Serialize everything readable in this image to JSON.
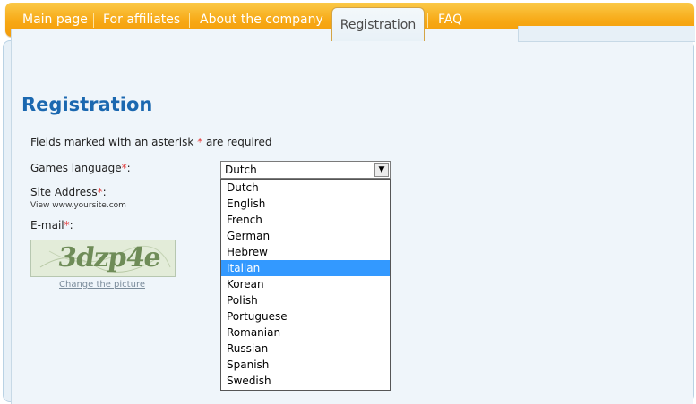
{
  "nav": {
    "items": [
      {
        "label": "Main page"
      },
      {
        "label": "For affiliates"
      },
      {
        "label": "About the company"
      },
      {
        "label": "Registration"
      },
      {
        "label": "FAQ"
      }
    ]
  },
  "page": {
    "title": "Registration",
    "required_note_prefix": "Fields marked with an asterisk",
    "required_note_asterisk": "*",
    "required_note_suffix": "are required"
  },
  "form": {
    "games_language_label": "Games language",
    "site_address_label": "Site Address",
    "site_address_hint": "View www.yoursite.com",
    "email_label": "E-mail",
    "asterisk": "*",
    "colon": ":",
    "captcha_text": "3dzp4e",
    "change_picture_label": "Change the picture"
  },
  "language_select": {
    "selected_value": "Dutch",
    "arrow_glyph": "▼",
    "highlighted": "Italian",
    "options": [
      "Dutch",
      "English",
      "French",
      "German",
      "Hebrew",
      "Italian",
      "Korean",
      "Polish",
      "Portuguese",
      "Romanian",
      "Russian",
      "Spanish",
      "Swedish"
    ]
  },
  "colors": {
    "nav_orange": "#f7a814",
    "title_blue": "#1b68b0",
    "required_red": "#e43b3b",
    "highlight_blue": "#3399ff"
  }
}
